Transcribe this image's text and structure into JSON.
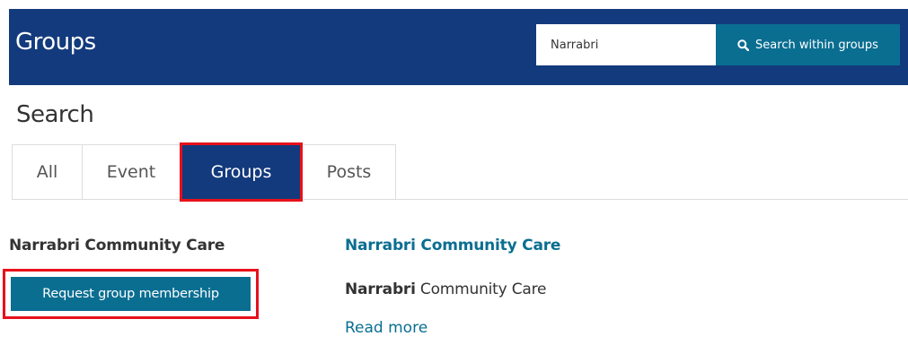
{
  "header": {
    "title": "Groups",
    "search_value": "Narrabri",
    "search_button_label": "Search within groups",
    "search_icon": "search-icon"
  },
  "page": {
    "title": "Search"
  },
  "tabs": [
    {
      "label": "All",
      "active": false
    },
    {
      "label": "Event",
      "active": false
    },
    {
      "label": "Groups",
      "active": true
    },
    {
      "label": "Posts",
      "active": false
    }
  ],
  "group_card": {
    "name": "Narrabri Community Care",
    "request_button_label": "Request group membership"
  },
  "result": {
    "title": "Narrabri Community Care",
    "description_highlight": "Narrabri",
    "description_rest": " Community Care",
    "read_more_label": "Read more"
  },
  "colors": {
    "header_bg": "#133a7c",
    "button_bg": "#0a6e91",
    "link": "#0a6e91",
    "highlight_outline": "#e8101a"
  }
}
